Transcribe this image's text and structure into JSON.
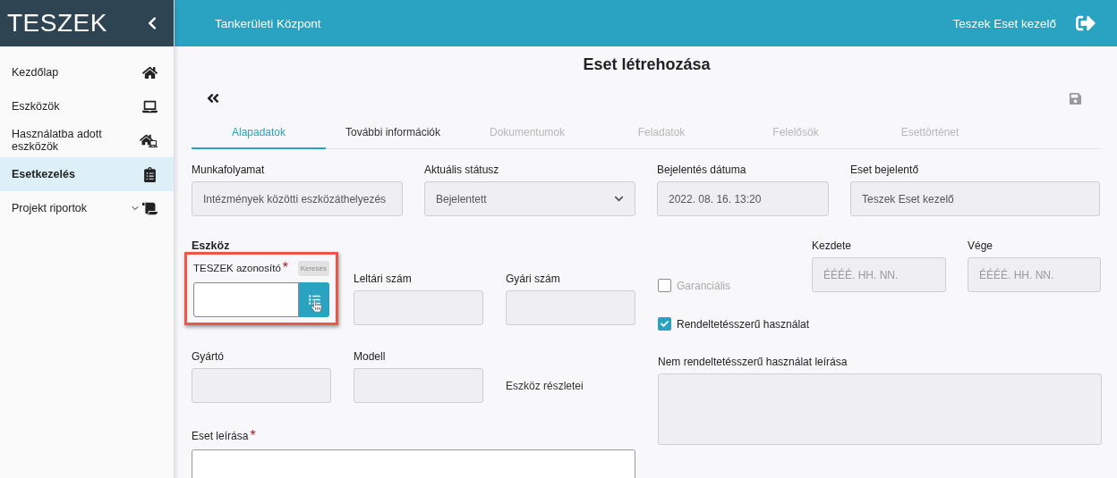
{
  "app": {
    "title": "TESZEK"
  },
  "topbar": {
    "organization": "Tankerületi Központ",
    "user": "Teszek Eset kezelő"
  },
  "sidebar": {
    "items": [
      {
        "label": "Kezdőlap",
        "selected": false,
        "expandable": false
      },
      {
        "label": "Eszközök",
        "selected": false,
        "expandable": false
      },
      {
        "label": "Használatba adott eszközök",
        "selected": false,
        "expandable": false
      },
      {
        "label": "Esetkezelés",
        "selected": true,
        "expandable": false
      },
      {
        "label": "Projekt riportok",
        "selected": false,
        "expandable": true
      }
    ]
  },
  "page": {
    "title": "Eset létrehozása"
  },
  "tabs": [
    {
      "label": "Alapadatok",
      "selected": true,
      "disabled": false
    },
    {
      "label": "További információk",
      "selected": false,
      "disabled": false
    },
    {
      "label": "Dokumentumok",
      "selected": false,
      "disabled": true
    },
    {
      "label": "Feladatok",
      "selected": false,
      "disabled": true
    },
    {
      "label": "Felelősök",
      "selected": false,
      "disabled": true
    },
    {
      "label": "Esettörténet",
      "selected": false,
      "disabled": true
    }
  ],
  "header_fields": [
    {
      "label": "Munkafolyamat",
      "value": "Intézmények közötti eszközáthelyezés",
      "kind": "text"
    },
    {
      "label": "Aktuális státusz",
      "value": "Bejelentett",
      "kind": "select"
    },
    {
      "label": "Bejelentés dátuma",
      "value": "2022. 08. 16. 13:20",
      "kind": "text"
    },
    {
      "label": "Eset bejelentő",
      "value": "Teszek Eset kezelő",
      "kind": "text"
    }
  ],
  "device": {
    "heading": "Eszköz",
    "id_field": {
      "label": "TESZEK azonosító",
      "required_mark": "*",
      "tooltip": "Keresés",
      "highlighted": true
    },
    "inventory_number": {
      "label": "Leltári szám"
    },
    "serial_number": {
      "label": "Gyári szám"
    },
    "manufacturer": {
      "label": "Gyártó"
    },
    "model": {
      "label": "Modell"
    },
    "details_link": "Eszköz részletei"
  },
  "warranty": {
    "label": "Garanciális",
    "checked": false,
    "disabled": true
  },
  "warranty_start": {
    "label": "Kezdete",
    "placeholder": "ÉÉÉÉ. HH. NN."
  },
  "warranty_end": {
    "label": "Vége",
    "placeholder": "ÉÉÉÉ. HH. NN."
  },
  "proper_use": {
    "label": "Rendeltetésszerű használat",
    "checked": true
  },
  "improper_use_description": {
    "label": "Nem rendeltetésszerű használat leírása"
  },
  "case_description": {
    "label": "Eset leírása",
    "required_mark": "*"
  }
}
